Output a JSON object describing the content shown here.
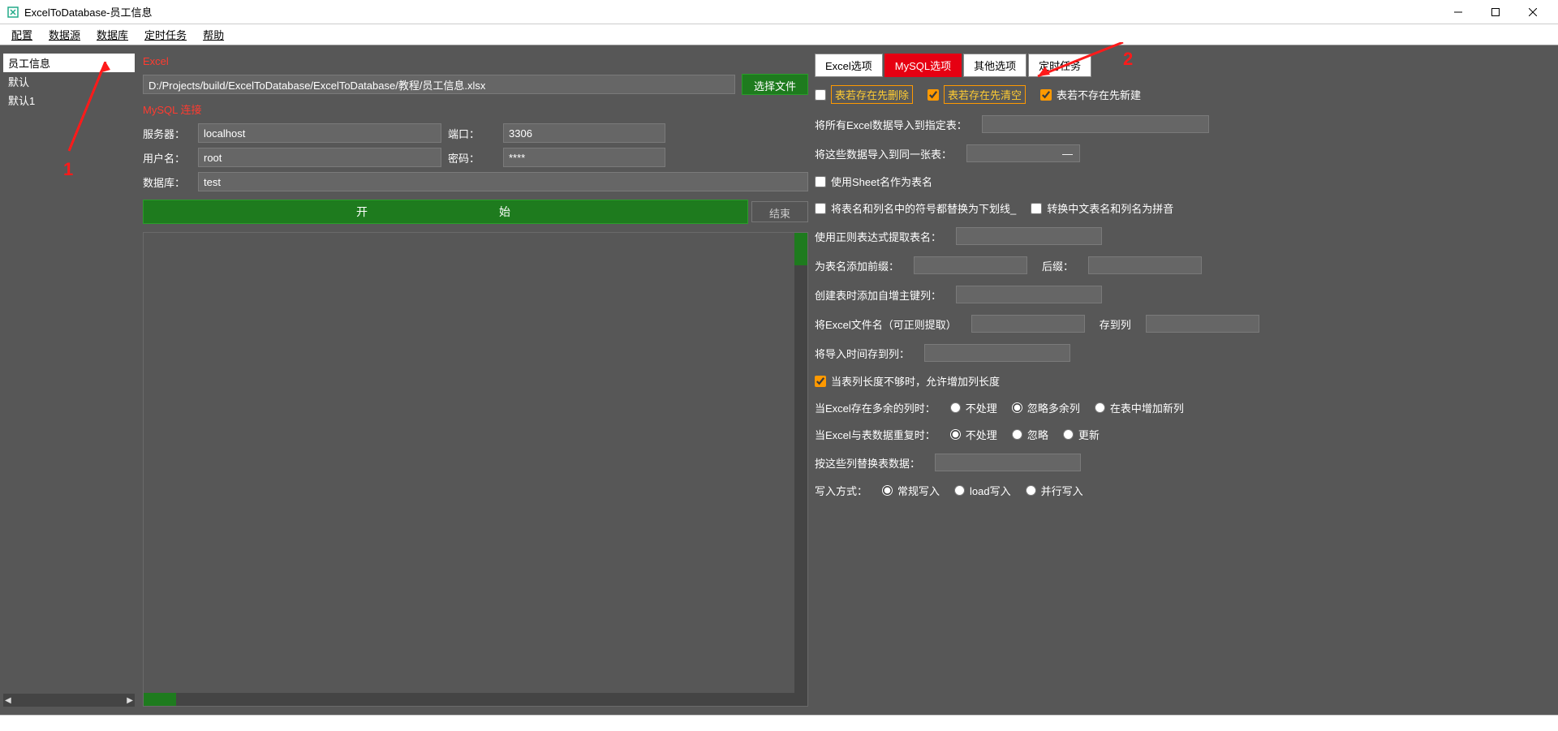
{
  "window": {
    "title": "ExcelToDatabase-员工信息"
  },
  "menu": {
    "config": "配置",
    "datasource": "数据源",
    "database": "数据库",
    "schedule": "定时任务",
    "help": "帮助"
  },
  "sidebar": {
    "items": [
      "员工信息",
      "默认",
      "默认1"
    ]
  },
  "excel": {
    "section_label": "Excel",
    "path": "D:/Projects/build/ExcelToDatabase/ExcelToDatabase/教程/员工信息.xlsx",
    "select_file_btn": "选择文件"
  },
  "mysql": {
    "section_label": "MySQL 连接",
    "server_label": "服务器：",
    "server": "localhost",
    "port_label": "端口：",
    "port": "3306",
    "user_label": "用户名：",
    "user": "root",
    "password_label": "密码：",
    "password": "****",
    "db_label": "数据库：",
    "db": "test"
  },
  "actions": {
    "start": "开　　　始",
    "stop": "结束"
  },
  "tabs": {
    "excel": "Excel选项",
    "mysql": "MySQL选项",
    "other": "其他选项",
    "schedule": "定时任务"
  },
  "opts": {
    "drop_first": "表若存在先删除",
    "truncate_first": "表若存在先清空",
    "create_if_absent": "表若不存在先新建",
    "import_all_to_table": "将所有Excel数据导入到指定表：",
    "import_to_same_table": "将这些数据导入到同一张表：",
    "same_table_btn": "—",
    "use_sheet_as_table": "使用Sheet名作为表名",
    "replace_symbols": "将表名和列名中的符号都替换为下划线_",
    "convert_pinyin": "转换中文表名和列名为拼音",
    "regex_extract_label": "使用正则表达式提取表名：",
    "prefix_label": "为表名添加前缀：",
    "suffix_label": "后缀：",
    "autoinc_label": "创建表时添加自增主键列：",
    "filename_col_label": "将Excel文件名（可正则提取）",
    "save_to_col": "存到列",
    "import_time_col": "将导入时间存到列：",
    "allow_widen": "当表列长度不够时，允许增加列长度",
    "extra_cols_label": "当Excel存在多余的列时：",
    "extra_cols_opts": [
      "不处理",
      "忽略多余列",
      "在表中增加新列"
    ],
    "dup_label": "当Excel与表数据重复时：",
    "dup_opts": [
      "不处理",
      "忽略",
      "更新"
    ],
    "replace_by_cols": "按这些列替换表数据：",
    "write_mode_label": "写入方式：",
    "write_mode_opts": [
      "常规写入",
      "load写入",
      "并行写入"
    ]
  },
  "annotations": {
    "one": "1",
    "two": "2"
  }
}
